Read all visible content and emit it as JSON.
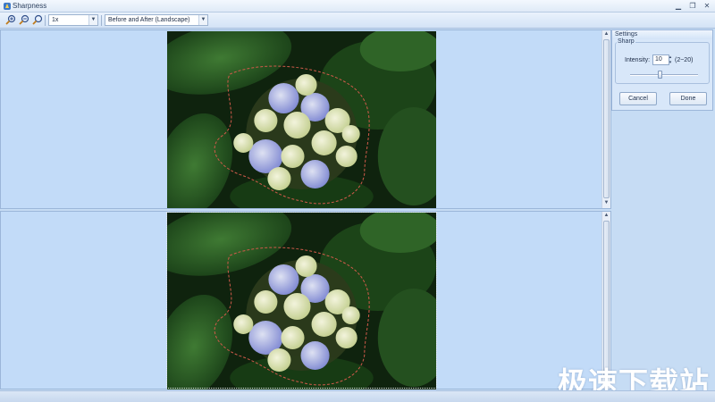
{
  "window": {
    "title": "Sharpness"
  },
  "toolbar": {
    "zoom_value": "1x",
    "view_mode_value": "Before and After (Landscape)"
  },
  "settings": {
    "header": "Settings",
    "group_label": "Sharp",
    "intensity_label": "Intensity:",
    "intensity_value": "10",
    "intensity_range": "(2~20)",
    "slider_level_fraction": 0.44,
    "cancel_label": "Cancel",
    "done_label": "Done"
  },
  "watermark": {
    "text": "极速下载站"
  },
  "colors": {
    "pane_bg": "#c2dbf8",
    "leaf": "#1f4a1c",
    "flower_blue": "#8f9be6",
    "flower_cream": "#eef2c8",
    "selection": "#d05a4a"
  },
  "icons": [
    "app-icon",
    "zoom-in-icon",
    "zoom-out-icon",
    "zoom-fit-icon",
    "minimize-icon",
    "restore-icon",
    "close-icon"
  ]
}
